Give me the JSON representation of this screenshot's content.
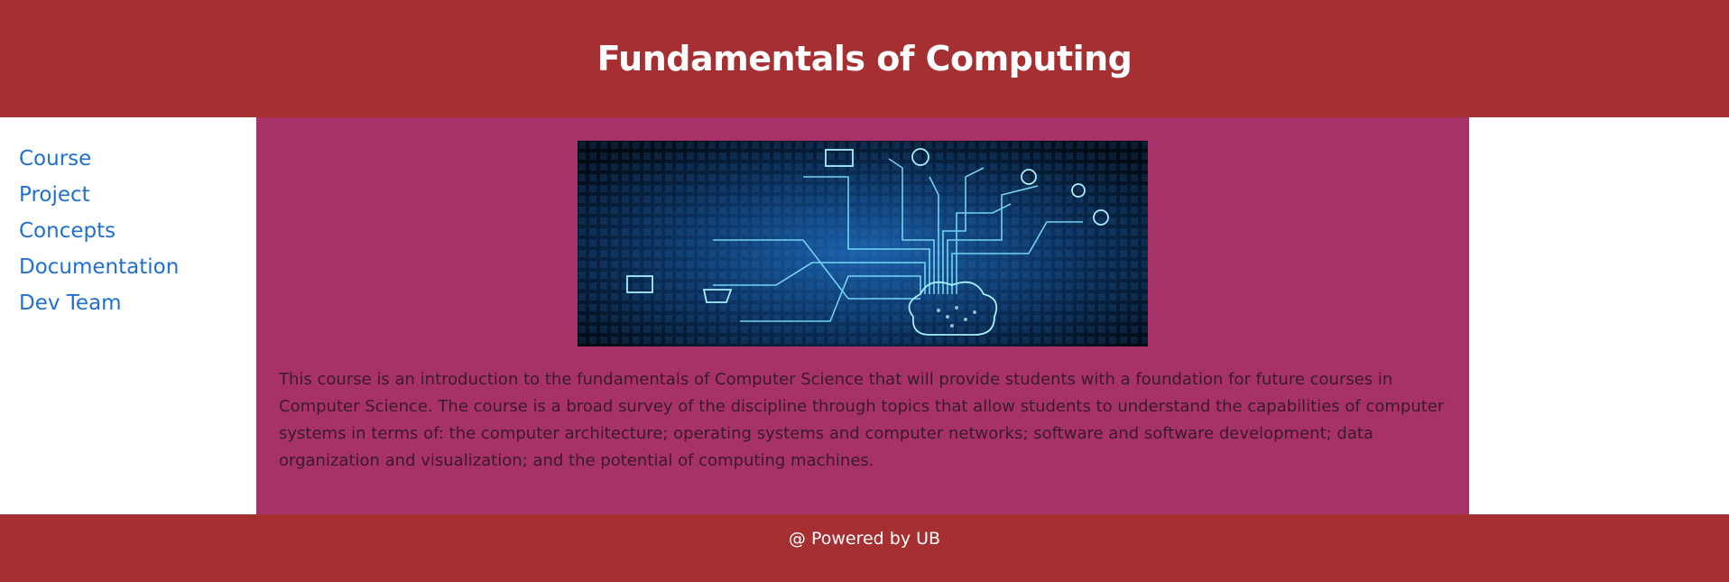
{
  "header": {
    "title": "Fundamentals of Computing"
  },
  "sidebar": {
    "items": [
      {
        "label": "Course"
      },
      {
        "label": "Project"
      },
      {
        "label": "Concepts"
      },
      {
        "label": "Documentation"
      },
      {
        "label": "Dev Team"
      }
    ]
  },
  "main": {
    "hero_image": "circuit-cloud-image",
    "description": "This course is an introduction to the fundamentals of Computer Science that will provide students with a foundation for future courses in Computer Science. The course is a broad survey of the discipline through topics that allow students to understand the capabilities of computer systems in terms of: the computer architecture; operating systems and computer networks; software and software development; data organization and visualization; and the potential of computing machines."
  },
  "footer": {
    "text": "@ Powered by UB"
  },
  "colors": {
    "header_bg": "#a52f31",
    "main_bg": "#a73267",
    "link": "#1f6fd1",
    "footer_bg": "#a52f31"
  }
}
